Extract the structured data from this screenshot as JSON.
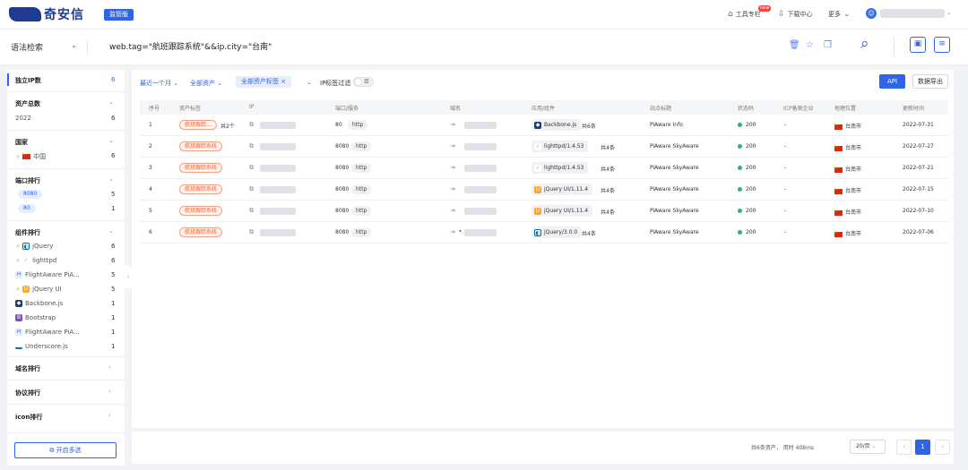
{
  "brand": {
    "name": "奇安信",
    "edition": "监管版"
  },
  "topnav": {
    "tools": "工具专栏",
    "tools_badge": "new",
    "downloads": "下载中心",
    "more": "更多"
  },
  "search": {
    "type": "语法检索",
    "query": "web.tag=\"航班跟踪系统\"&&ip.city=\"台南\""
  },
  "sidebar": {
    "unique_ip": {
      "label": "独立IP数",
      "count": "6"
    },
    "total_assets": {
      "label": "资产总数",
      "year": "2022",
      "count": "6"
    },
    "country": {
      "label": "国家",
      "items": [
        {
          "name": "中国",
          "count": "6"
        }
      ]
    },
    "ports": {
      "label": "端口排行",
      "items": [
        {
          "port": "8080",
          "count": "5"
        },
        {
          "port": "80",
          "count": "1"
        }
      ]
    },
    "components": {
      "label": "组件排行",
      "items": [
        {
          "name": "jQuery",
          "count": "6",
          "icon": "jquery-icon"
        },
        {
          "name": "lighttpd",
          "count": "6",
          "icon": "lighttpd-icon"
        },
        {
          "name": "FlightAware PiA...",
          "count": "5",
          "icon": "flightaware-icon"
        },
        {
          "name": "jQuery UI",
          "count": "5",
          "icon": "jquery-ui-icon"
        },
        {
          "name": "Backbone.js",
          "count": "1",
          "icon": "backbone-icon"
        },
        {
          "name": "Bootstrap",
          "count": "1",
          "icon": "bootstrap-icon"
        },
        {
          "name": "FlightAware PiA...",
          "count": "1",
          "icon": "flightaware-icon"
        },
        {
          "name": "Underscore.js",
          "count": "1",
          "icon": "underscore-icon"
        }
      ]
    },
    "domain_rank": "域名排行",
    "protocol_rank": "协议排行",
    "icon_rank": "icon排行",
    "multi_select": "开启多选"
  },
  "filters": {
    "time": "最近一个月",
    "assets": "全部资产",
    "tags": "全部资产标签",
    "ip_tag_filter": "IP标签过滤",
    "toggle_state": "否",
    "api": "API",
    "export": "数据导出"
  },
  "columns": [
    "序号",
    "资产标签",
    "IP",
    "端口/服务",
    "域名",
    "应用/组件",
    "站点标题",
    "状态码",
    "ICP备案企业",
    "地理位置",
    "更新时间"
  ],
  "rows": [
    {
      "no": "1",
      "tag": "航班跟踪...",
      "tag_more": "共2个",
      "port": "80",
      "service": "http",
      "domain_prefix": "",
      "component": "Backbone.js",
      "comp_icon": "backbone-icon",
      "comp_more": "共6条",
      "title": "PiAware Info",
      "status": "200",
      "icp": "-",
      "location": "台南市",
      "date": "2022-07-31"
    },
    {
      "no": "2",
      "tag": "航班跟踪系统",
      "tag_more": "",
      "port": "8080",
      "service": "http",
      "domain_prefix": "",
      "component": "lighttpd/1.4.53",
      "comp_icon": "lighttpd-icon",
      "comp_more": "共4条",
      "title": "PiAware SkyAware",
      "status": "200",
      "icp": "-",
      "location": "台南市",
      "date": "2022-07-27"
    },
    {
      "no": "3",
      "tag": "航班跟踪系统",
      "tag_more": "",
      "port": "8080",
      "service": "http",
      "domain_prefix": "",
      "component": "lighttpd/1.4.53",
      "comp_icon": "lighttpd-icon",
      "comp_more": "共4条",
      "title": "PiAware SkyAware",
      "status": "200",
      "icp": "-",
      "location": "台南市",
      "date": "2022-07-21"
    },
    {
      "no": "4",
      "tag": "航班跟踪系统",
      "tag_more": "",
      "port": "8080",
      "service": "http",
      "domain_prefix": "",
      "component": "jQuery UI/1.11.4",
      "comp_icon": "jquery-ui-icon",
      "comp_more": "共4条",
      "title": "PiAware SkyAware",
      "status": "200",
      "icp": "-",
      "location": "台南市",
      "date": "2022-07-15"
    },
    {
      "no": "5",
      "tag": "航班跟踪系统",
      "tag_more": "",
      "port": "8080",
      "service": "http",
      "domain_prefix": "",
      "component": "jQuery UI/1.11.4",
      "comp_icon": "jquery-ui-icon",
      "comp_more": "共4条",
      "title": "PiAware SkyAware",
      "status": "200",
      "icp": "-",
      "location": "台南市",
      "date": "2022-07-10"
    },
    {
      "no": "6",
      "tag": "航班跟踪系统",
      "tag_more": "",
      "port": "8080",
      "service": "http",
      "domain_prefix": "*.",
      "component": "jQuery/3.0.0",
      "comp_icon": "jquery-icon",
      "comp_more": "共4条",
      "title": "PiAware SkyAware",
      "status": "200",
      "icp": "-",
      "location": "台南市",
      "date": "2022-07-06"
    }
  ],
  "pagination": {
    "summary": "共6条资产，  用时 408ms",
    "page_size": "20/页",
    "current": "1"
  }
}
